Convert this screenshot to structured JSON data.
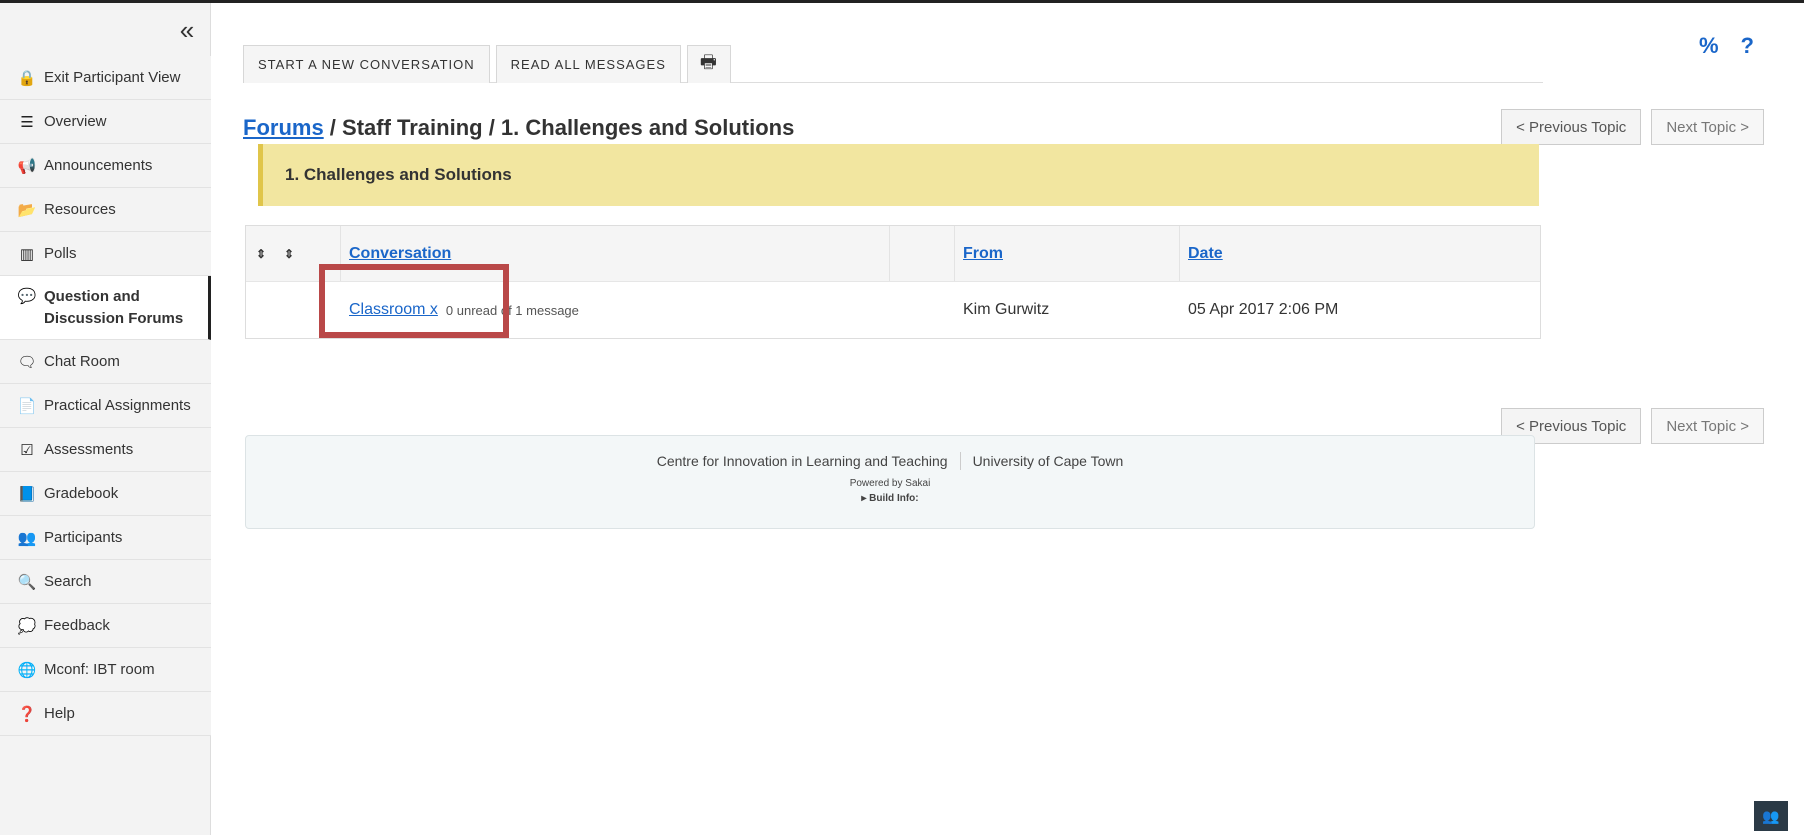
{
  "sidebar": {
    "collapse_glyph": "«",
    "items": [
      {
        "label": "Exit Participant View",
        "icon": "lock-icon",
        "glyph": "🔒"
      },
      {
        "label": "Overview",
        "icon": "list-icon",
        "glyph": "☰"
      },
      {
        "label": "Announcements",
        "icon": "megaphone-icon",
        "glyph": "📢"
      },
      {
        "label": "Resources",
        "icon": "folder-icon",
        "glyph": "📂"
      },
      {
        "label": "Polls",
        "icon": "bar-chart-icon",
        "glyph": "▥"
      },
      {
        "label": "Question and\nDiscussion Forums",
        "icon": "comments-icon",
        "glyph": "💬"
      },
      {
        "label": "Chat Room",
        "icon": "chat-icon",
        "glyph": "🗨"
      },
      {
        "label": "Practical Assignments",
        "icon": "file-icon",
        "glyph": "📄"
      },
      {
        "label": "Assessments",
        "icon": "checkbox-icon",
        "glyph": "☑"
      },
      {
        "label": "Gradebook",
        "icon": "book-icon",
        "glyph": "📘"
      },
      {
        "label": "Participants",
        "icon": "users-icon",
        "glyph": "👥"
      },
      {
        "label": "Search",
        "icon": "search-icon",
        "glyph": "🔍"
      },
      {
        "label": "Feedback",
        "icon": "speech-bubble-icon",
        "glyph": "💭"
      },
      {
        "label": "Mconf: IBT room",
        "icon": "globe-icon",
        "glyph": "🌐"
      },
      {
        "label": "Help",
        "icon": "question-circle-icon",
        "glyph": "❓"
      }
    ]
  },
  "toolbar": {
    "start_label": "START A NEW CONVERSATION",
    "read_label": "READ ALL MESSAGES",
    "print_glyph": "🖶"
  },
  "top_icons": {
    "link_glyph": "%",
    "help_glyph": "?"
  },
  "breadcrumb": {
    "forums": "Forums",
    "rest": " / Staff Training / 1. Challenges and Solutions"
  },
  "nav": {
    "previous": "< Previous Topic",
    "next": "Next Topic >"
  },
  "topic": {
    "title": "1. Challenges and Solutions"
  },
  "table": {
    "sort_glyph": "⇕",
    "headers": {
      "conversation": "Conversation",
      "from": "From",
      "date": "Date"
    },
    "rows": [
      {
        "conversation": "Classroom x",
        "meta": "0 unread of 1 message",
        "from": "Kim Gurwitz",
        "date": "05 Apr 2017 2:06 PM"
      }
    ]
  },
  "footer": {
    "org": "Centre for Innovation in Learning and Teaching",
    "university": "University of Cape Town",
    "powered": "Powered by Sakai",
    "build": "▸ Build Info:"
  },
  "corner": {
    "glyph": "👥"
  },
  "colors": {
    "link": "#1a66c9",
    "banner": "#f2e6a0",
    "highlight": "#b94848"
  }
}
